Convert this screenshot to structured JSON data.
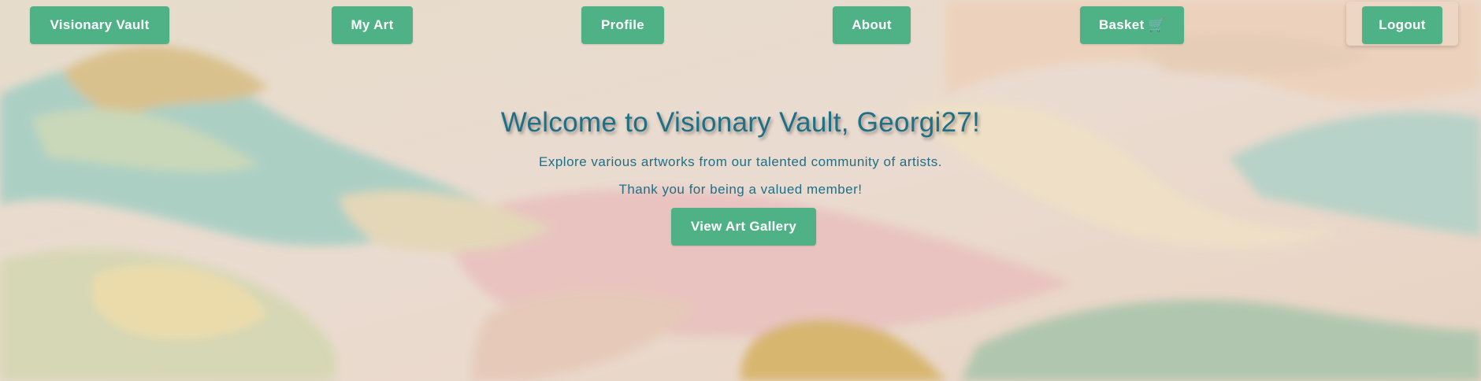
{
  "nav": {
    "brand_label": "Visionary Vault",
    "my_art_label": "My Art",
    "profile_label": "Profile",
    "about_label": "About",
    "basket_label": "Basket 🛒",
    "logout_label": "Logout"
  },
  "hero": {
    "title": "Welcome to Visionary Vault, Georgi27!",
    "line1": "Explore various artworks from our talented community of artists.",
    "line2": "Thank you for being a valued member!",
    "cta_label": "View Art Gallery"
  },
  "colors": {
    "button_bg": "#4fb286",
    "button_text": "#ffffff",
    "heading_text": "#1f6f86"
  },
  "icons": {
    "basket": "shopping-cart-icon"
  }
}
